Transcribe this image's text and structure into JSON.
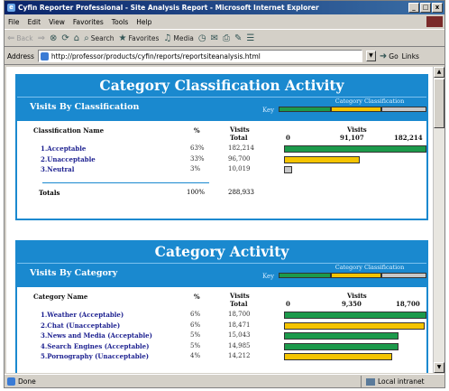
{
  "window": {
    "title": "Cyfin Reporter Professional - Site Analysis Report - Microsoft Internet Explorer",
    "controls": [
      "_",
      "□",
      "x"
    ]
  },
  "menu": [
    "File",
    "Edit",
    "View",
    "Favorites",
    "Tools",
    "Help"
  ],
  "toolbar": {
    "back": "Back",
    "search": "Search",
    "favorites": "Favorites",
    "media": "Media"
  },
  "address": {
    "label": "Address",
    "url": "http://professor/products/cyfin/reports/reportsiteanalysis.html",
    "go": "Go",
    "links": "Links"
  },
  "status": {
    "left": "Done",
    "right": "Local intranet"
  },
  "colors": {
    "panel_blue": "#1a89cf",
    "acceptable_green": "#1c9a4b",
    "unacceptable_yellow": "#f5c400",
    "neutral_gray": "#c8c8c8"
  },
  "panel1": {
    "title": "Category Classification Activity",
    "subtitle": "Visits By Classification",
    "key_label": "Key",
    "key_caption": "Category Classification",
    "col_name": "Classification Name",
    "col_pct": "%",
    "col_visits_1": "Visits",
    "col_visits_2": "Total",
    "scale_header": "Visits",
    "scale_0": "0",
    "scale_mid": "91,107",
    "scale_max": "182,214",
    "rows": [
      {
        "name": "1.Acceptable",
        "pct": "63%",
        "visits": "182,214",
        "value": 182214,
        "status": "g"
      },
      {
        "name": "2.Unacceptable",
        "pct": "33%",
        "visits": "96,700",
        "value": 96700,
        "status": "y"
      },
      {
        "name": "3.Neutral",
        "pct": "3%",
        "visits": "10,019",
        "value": 10019,
        "status": "s"
      }
    ],
    "scale_max_value": 182214,
    "totals_label": "Totals",
    "totals_pct": "100%",
    "totals_visits": "288,933"
  },
  "panel2": {
    "title": "Category Activity",
    "subtitle": "Visits By Category",
    "key_label": "Key",
    "key_caption": "Category Classification",
    "col_name": "Category Name",
    "col_pct": "%",
    "col_visits_1": "Visits",
    "col_visits_2": "Total",
    "scale_header": "Visits",
    "scale_0": "0",
    "scale_mid": "9,350",
    "scale_max": "18,700",
    "rows": [
      {
        "name": "1.Weather (Acceptable)",
        "pct": "6%",
        "visits": "18,700",
        "value": 18700,
        "status": "g"
      },
      {
        "name": "2.Chat (Unacceptable)",
        "pct": "6%",
        "visits": "18,471",
        "value": 18471,
        "status": "y"
      },
      {
        "name": "3.News and Media (Acceptable)",
        "pct": "5%",
        "visits": "15,043",
        "value": 15043,
        "status": "g"
      },
      {
        "name": "4.Search Engines (Acceptable)",
        "pct": "5%",
        "visits": "14,985",
        "value": 14985,
        "status": "g"
      },
      {
        "name": "5.Pornography (Unacceptable)",
        "pct": "4%",
        "visits": "14,212",
        "value": 14212,
        "status": "y"
      }
    ],
    "scale_max_value": 18700
  }
}
